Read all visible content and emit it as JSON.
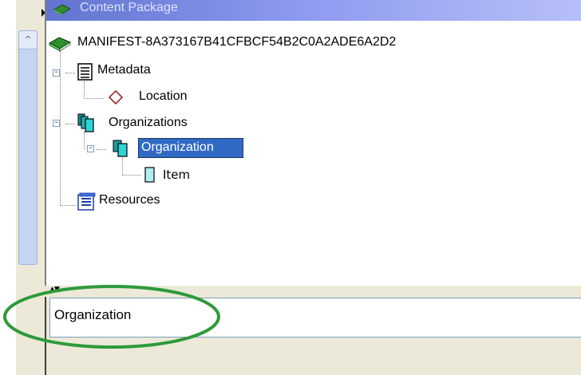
{
  "window": {
    "title": "Content Package"
  },
  "tree": {
    "root": "MANIFEST-8A373167B41CFBCF54B2C0A2ADE6A2D2",
    "metadata": "Metadata",
    "location": "Location",
    "organizations": "Organizations",
    "organization": "Organization",
    "item": "Item",
    "resources": "Resources"
  },
  "scroll": {
    "up_glyph": "^"
  },
  "splitter": {
    "glyph": "▲▼"
  },
  "field": {
    "value": "Organization"
  },
  "colors": {
    "selection": "#316ac5",
    "callout": "#2e9a3a",
    "titlebar": "#6274d0"
  },
  "icons": [
    "book-icon",
    "document-icon",
    "diamond-icon",
    "folders-icon",
    "folder-icon",
    "page-icon",
    "resources-icon"
  ]
}
